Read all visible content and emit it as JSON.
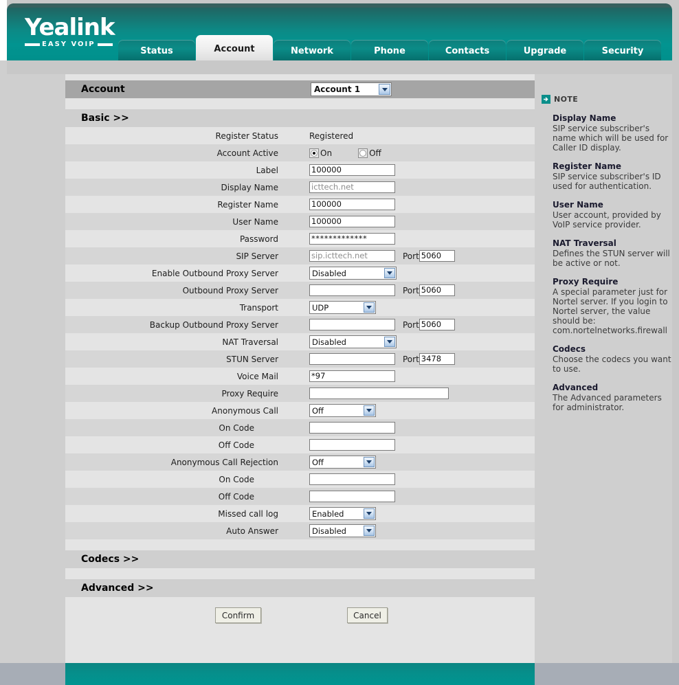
{
  "brand": {
    "name": "Yealink",
    "tagline": "EASY VOIP"
  },
  "tabs": [
    {
      "label": "Status",
      "active": false
    },
    {
      "label": "Account",
      "active": true
    },
    {
      "label": "Network",
      "active": false
    },
    {
      "label": "Phone",
      "active": false
    },
    {
      "label": "Contacts",
      "active": false
    },
    {
      "label": "Upgrade",
      "active": false
    },
    {
      "label": "Security",
      "active": false
    }
  ],
  "account_section": {
    "title": "Account",
    "selected": "Account 1"
  },
  "basic_section": {
    "title": "Basic >>"
  },
  "codecs_section": {
    "title": "Codecs >>"
  },
  "advanced_section": {
    "title": "Advanced >>"
  },
  "fields": {
    "register_status": {
      "label": "Register Status",
      "value": "Registered"
    },
    "account_active": {
      "label": "Account Active",
      "on_label": "On",
      "off_label": "Off",
      "selected": "On"
    },
    "label": {
      "label": "Label",
      "value": "100000"
    },
    "display_name": {
      "label": "Display Name",
      "value": "icttech.net",
      "is_placeholder": true
    },
    "register_name": {
      "label": "Register Name",
      "value": "100000"
    },
    "user_name": {
      "label": "User Name",
      "value": "100000"
    },
    "password": {
      "label": "Password",
      "value": "*************"
    },
    "sip_server": {
      "label": "SIP Server",
      "value": "sip.icttech.net",
      "is_placeholder": true,
      "port_label": "Port",
      "port": "5060"
    },
    "enable_outbound_proxy": {
      "label": "Enable Outbound Proxy Server",
      "value": "Disabled"
    },
    "outbound_proxy_server": {
      "label": "Outbound Proxy Server",
      "value": "",
      "port_label": "Port",
      "port": "5060"
    },
    "transport": {
      "label": "Transport",
      "value": "UDP"
    },
    "backup_outbound_proxy_server": {
      "label": "Backup Outbound Proxy Server",
      "value": "",
      "port_label": "Port",
      "port": "5060"
    },
    "nat_traversal": {
      "label": "NAT Traversal",
      "value": "Disabled"
    },
    "stun_server": {
      "label": "STUN Server",
      "value": "",
      "port_label": "Port",
      "port": "3478"
    },
    "voice_mail": {
      "label": "Voice Mail",
      "value": "*97"
    },
    "proxy_require": {
      "label": "Proxy Require",
      "value": ""
    },
    "anonymous_call": {
      "label": "Anonymous Call",
      "value": "Off"
    },
    "anon_on_code": {
      "label": "On Code",
      "value": ""
    },
    "anon_off_code": {
      "label": "Off Code",
      "value": ""
    },
    "anonymous_call_rejection": {
      "label": "Anonymous Call Rejection",
      "value": "Off"
    },
    "rej_on_code": {
      "label": "On Code",
      "value": ""
    },
    "rej_off_code": {
      "label": "Off Code",
      "value": ""
    },
    "missed_call_log": {
      "label": "Missed call log",
      "value": "Enabled"
    },
    "auto_answer": {
      "label": "Auto Answer",
      "value": "Disabled"
    }
  },
  "buttons": {
    "confirm": "Confirm",
    "cancel": "Cancel"
  },
  "note": {
    "title": "NOTE",
    "blocks": [
      {
        "heading": "Display Name",
        "text": "SIP service subscriber's name which will be used for Caller ID display."
      },
      {
        "heading": "Register Name",
        "text": "SIP service subscriber's ID used for authentication."
      },
      {
        "heading": "User Name",
        "text": "User account, provided by VoIP service provider."
      },
      {
        "heading": "NAT Traversal",
        "text": "Defines the STUN server will be active or not."
      },
      {
        "heading": "Proxy Require",
        "text": "A special parameter just for Nortel server. If you login to Nortel server, the value should be: com.nortelnetworks.firewall"
      },
      {
        "heading": "Codecs",
        "text": "Choose the codecs you want to use."
      },
      {
        "heading": "Advanced",
        "text": "The Advanced parameters for administrator."
      }
    ]
  },
  "colors": {
    "brand_teal": "#009490",
    "header_dark": "#2a5c5a",
    "section_bar": "#a5a5a5",
    "row_odd": "#e4e4e4",
    "row_even": "#d6d6d6",
    "page_bg": "#cfcfcf"
  }
}
